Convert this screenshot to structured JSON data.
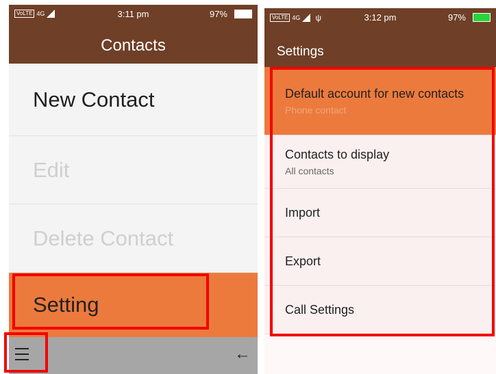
{
  "left": {
    "status": {
      "network": "4G",
      "volte": "VoLTE",
      "time": "3:11 pm",
      "battery": "97%"
    },
    "title": "Contacts",
    "items": [
      {
        "label": "New Contact",
        "state": "enabled"
      },
      {
        "label": "Edit",
        "state": "disabled"
      },
      {
        "label": "Delete Contact",
        "state": "disabled"
      },
      {
        "label": "Setting",
        "state": "selected"
      }
    ],
    "softkeys": {
      "left_icon": "hamburger-menu-icon",
      "right_icon": "back-arrow-icon",
      "right_glyph": "←"
    }
  },
  "right": {
    "status": {
      "network": "4G",
      "volte": "VoLTE",
      "usb": "ψ",
      "time": "3:12 pm",
      "battery": "97%"
    },
    "title": "Settings",
    "items": [
      {
        "label": "Default account for new contacts",
        "sub": "Phone contact",
        "state": "selected"
      },
      {
        "label": "Contacts to display",
        "sub": "All contacts",
        "state": "enabled"
      },
      {
        "label": "Import",
        "state": "enabled"
      },
      {
        "label": "Export",
        "state": "enabled"
      },
      {
        "label": "Call Settings",
        "state": "enabled"
      }
    ]
  },
  "colors": {
    "header": "#6f3f27",
    "highlight": "#ec7a3d",
    "annotation": "#f40000"
  }
}
